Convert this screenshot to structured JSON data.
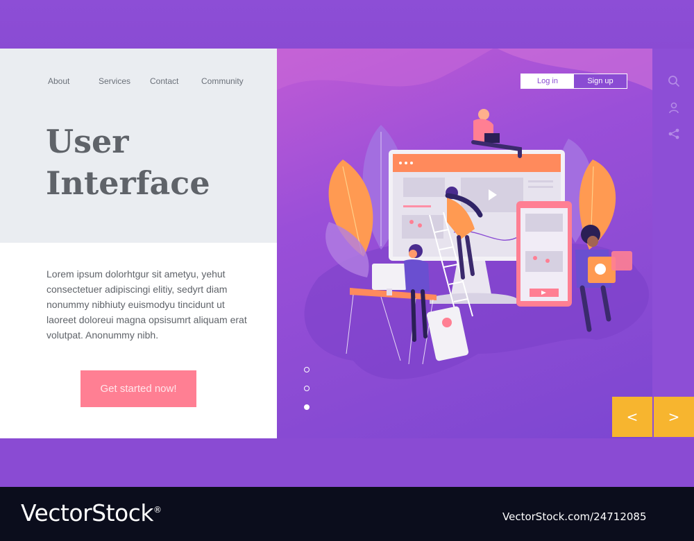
{
  "nav": {
    "items": [
      {
        "label": "About"
      },
      {
        "label": "Services"
      },
      {
        "label": "Contact"
      },
      {
        "label": "Community"
      }
    ]
  },
  "hero": {
    "title_line1": "User",
    "title_line2": "Interface",
    "body": "Lorem ipsum dolorhtgur sit ametyu, yehut consectetuer adipiscingi elitiy, sedyrt diam nonummy nibhiuty euismodyu tincidunt ut laoreet doloreui magna opsisumrt aliquam erat volutpat. Anonummy nibh.",
    "cta_label": "Get started now!"
  },
  "auth": {
    "login_label": "Log in",
    "signup_label": "Sign up"
  },
  "side_icons": [
    "search-icon",
    "user-icon",
    "share-icon"
  ],
  "slider": {
    "dots": 3,
    "active_index": 2,
    "prev_symbol": "<",
    "next_symbol": ">"
  },
  "colors": {
    "accent_purple": "#8a4bd3",
    "cta_pink": "#ff7f93",
    "arrow_yellow": "#f7b52f",
    "panel_gray": "#eaedf1",
    "text_gray": "#5f6369"
  },
  "watermark": {
    "brand": "VectorStock",
    "registered": "®",
    "url": "VectorStock.com/24712085"
  }
}
